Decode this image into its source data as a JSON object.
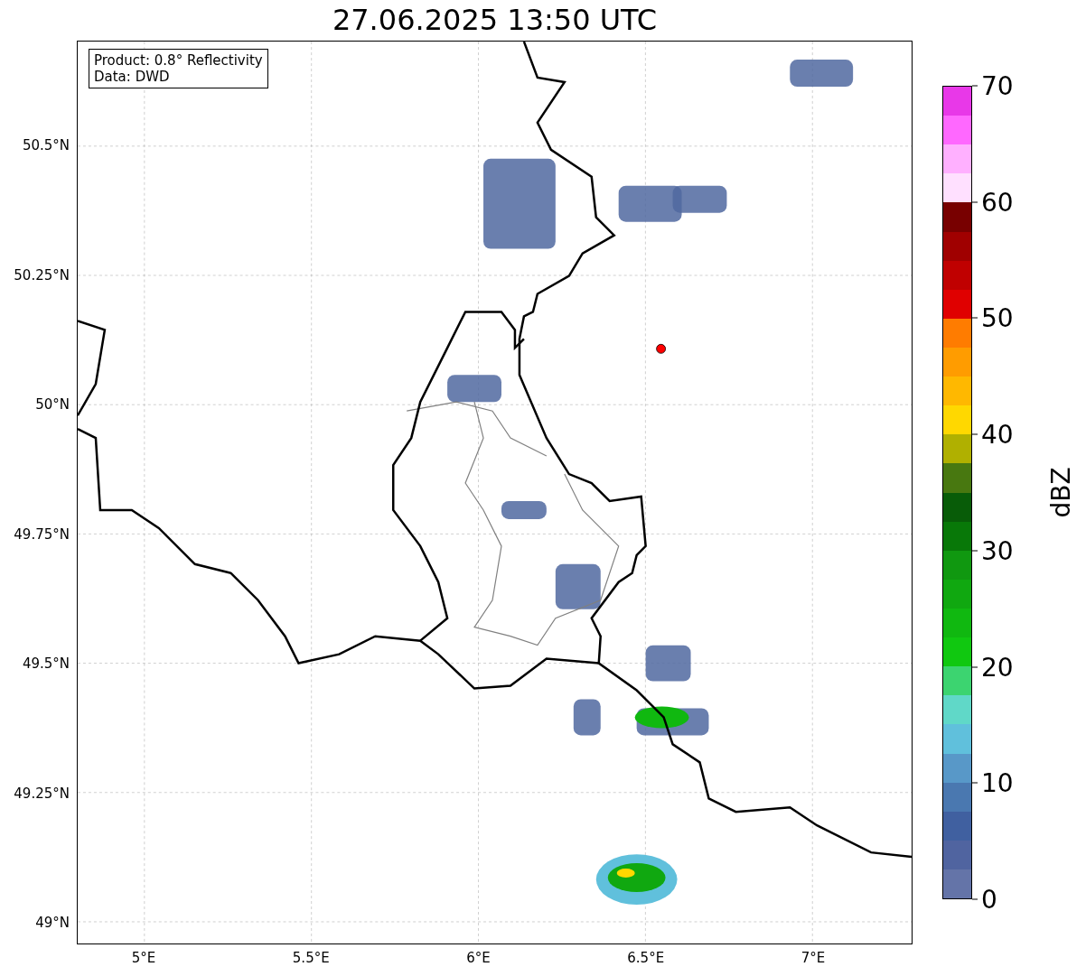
{
  "title": "27.06.2025 13:50 UTC",
  "info_box": [
    "Product: 0.8° Reflectivity",
    "Data: DWD"
  ],
  "map": {
    "xticks": [
      "5°E",
      "5.5°E",
      "6°E",
      "6.5°E",
      "7°E"
    ],
    "yticks": [
      "50.5°N",
      "50.25°N",
      "50°N",
      "49.75°N",
      "49.5°N",
      "49.25°N",
      "49°N"
    ]
  },
  "colorbar": {
    "label": "dBZ",
    "ticks": [
      "70",
      "60",
      "50",
      "40",
      "30",
      "20",
      "10",
      "0"
    ],
    "segments": [
      {
        "color": "#e838e8"
      },
      {
        "color": "#ff68ff"
      },
      {
        "color": "#ffb0ff"
      },
      {
        "color": "#ffe0ff"
      },
      {
        "color": "#780000"
      },
      {
        "color": "#a00000"
      },
      {
        "color": "#c00000"
      },
      {
        "color": "#e00000"
      },
      {
        "color": "#ff7c00"
      },
      {
        "color": "#ff9c00"
      },
      {
        "color": "#ffb800"
      },
      {
        "color": "#ffd800"
      },
      {
        "color": "#b0b000"
      },
      {
        "color": "#487810"
      },
      {
        "color": "#085c08"
      },
      {
        "color": "#087808"
      },
      {
        "color": "#109810"
      },
      {
        "color": "#10a810"
      },
      {
        "color": "#10b810"
      },
      {
        "color": "#10c810"
      },
      {
        "color": "#3cd470"
      },
      {
        "color": "#60d8c8"
      },
      {
        "color": "#60c0dc"
      },
      {
        "color": "#5898c8"
      },
      {
        "color": "#4a78b0"
      },
      {
        "color": "#4060a0"
      },
      {
        "color": "#5064a0"
      },
      {
        "color": "#6474a8"
      }
    ]
  }
}
